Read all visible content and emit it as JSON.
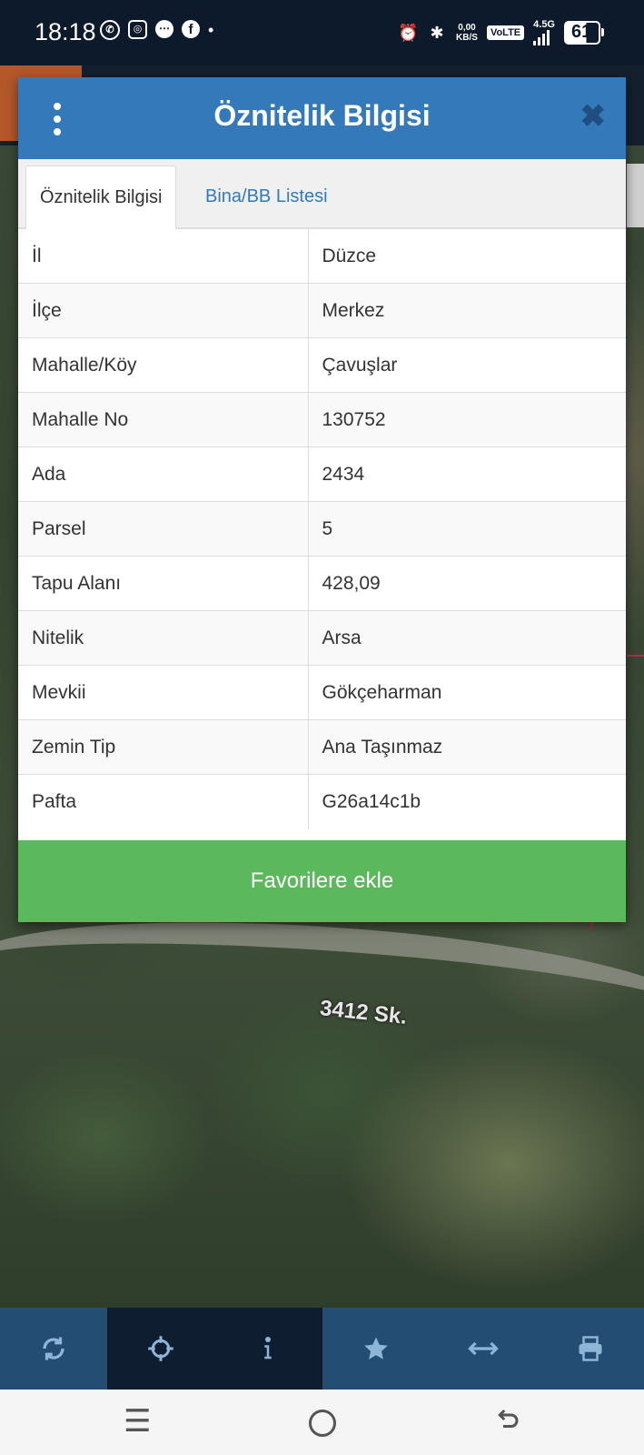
{
  "status_bar": {
    "time": "18:18",
    "speed_value": "0,00",
    "speed_unit": "KB/S",
    "volte": "VoLTE",
    "network": "4.5G",
    "battery": "61"
  },
  "map": {
    "street_label": "3412 Sk."
  },
  "dialog": {
    "title": "Öznitelik Bilgisi",
    "tabs": [
      {
        "label": "Öznitelik Bilgisi",
        "active": true
      },
      {
        "label": "Bina/BB Listesi",
        "active": false
      }
    ],
    "rows": [
      {
        "key": "İl",
        "value": "Düzce"
      },
      {
        "key": "İlçe",
        "value": "Merkez"
      },
      {
        "key": "Mahalle/Köy",
        "value": "Çavuşlar"
      },
      {
        "key": "Mahalle No",
        "value": "130752"
      },
      {
        "key": "Ada",
        "value": "2434"
      },
      {
        "key": "Parsel",
        "value": "5"
      },
      {
        "key": "Tapu Alanı",
        "value": "428,09"
      },
      {
        "key": "Nitelik",
        "value": "Arsa"
      },
      {
        "key": "Mevkii",
        "value": "Gökçeharman"
      },
      {
        "key": "Zemin Tip",
        "value": "Ana Taşınmaz"
      },
      {
        "key": "Pafta",
        "value": "G26a14c1b"
      }
    ],
    "favorite_button": "Favorilere ekle"
  },
  "toolbar": {
    "icons": [
      "refresh-icon",
      "locate-icon",
      "info-icon",
      "star-icon",
      "measure-icon",
      "print-icon"
    ]
  },
  "colors": {
    "header": "#3479b9",
    "favorite_button": "#5cb85c",
    "toolbar": "#244d73",
    "toolbar_active": "#0e1e30"
  }
}
